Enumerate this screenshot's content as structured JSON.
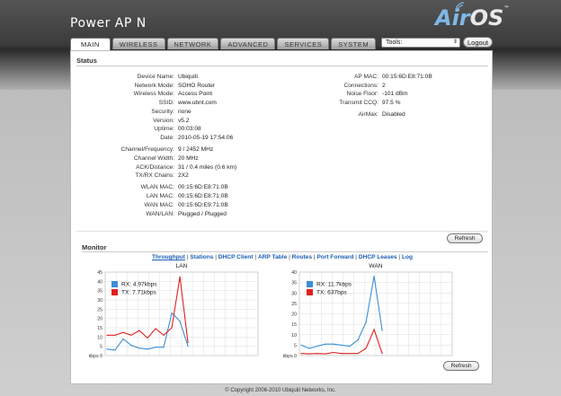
{
  "header": {
    "product": "Power AP N",
    "logo_air": "Air",
    "logo_os": "OS",
    "logo_tm": "™",
    "tabs": [
      "MAIN",
      "WIRELESS",
      "NETWORK",
      "ADVANCED",
      "SERVICES",
      "SYSTEM"
    ],
    "active_tab": "MAIN",
    "tools_label": "Tools:",
    "logout_label": "Logout"
  },
  "status": {
    "title": "Status",
    "left_group1": [
      {
        "k": "Device Name:",
        "v": "Ubiquiti"
      },
      {
        "k": "Network Mode:",
        "v": "SOHO Router"
      },
      {
        "k": "Wireless Mode:",
        "v": "Access Point"
      },
      {
        "k": "SSID:",
        "v": "www.ubnt.com"
      },
      {
        "k": "Security:",
        "v": "none"
      },
      {
        "k": "Version:",
        "v": "v5.2"
      },
      {
        "k": "Uptime:",
        "v": "00:03:08"
      },
      {
        "k": "Date:",
        "v": "2010-05-19 17:54:06"
      }
    ],
    "left_group2": [
      {
        "k": "Channel/Frequency:",
        "v": "9 / 2452 MHz"
      },
      {
        "k": "Channel Width:",
        "v": "20 MHz"
      },
      {
        "k": "ACK/Distance:",
        "v": "31 / 0.4 miles (0.6 km)"
      },
      {
        "k": "TX/RX Chains:",
        "v": "2X2"
      }
    ],
    "left_group3": [
      {
        "k": "WLAN MAC:",
        "v": "00:15:6D:E8:71:0B"
      },
      {
        "k": "LAN MAC:",
        "v": "00:15:6D:E8:71:0B"
      },
      {
        "k": "WAN MAC:",
        "v": "00:15:6D:E9:71:0B"
      },
      {
        "k": "WAN/LAN:",
        "v": "Plugged / Plugged"
      }
    ],
    "right_group1": [
      {
        "k": "AP MAC:",
        "v": "00:15:6D:E8:71:0B"
      },
      {
        "k": "Connections:",
        "v": "2"
      },
      {
        "k": "Noise Floor:",
        "v": "-101 dBm"
      },
      {
        "k": "Transmit CCQ:",
        "v": "97.5 %"
      }
    ],
    "right_group2": [
      {
        "k": "AirMax:",
        "v": "Disabled"
      }
    ],
    "refresh_label": "Refresh"
  },
  "monitor": {
    "title": "Monitor",
    "links": [
      "Throughput",
      "Stations",
      "DHCP Client",
      "ARP Table",
      "Routes",
      "Port Forward",
      "DHCP Leases",
      "Log"
    ],
    "active_link": "Throughput",
    "refresh_label": "Refresh"
  },
  "chart_data": [
    {
      "type": "line",
      "title": "LAN",
      "ylabel": "kbps",
      "ylim": [
        0,
        45
      ],
      "yticks": [
        0,
        5,
        10,
        15,
        20,
        25,
        30,
        35,
        40,
        45
      ],
      "grid": true,
      "legend": "top-left",
      "series": [
        {
          "name": "RX: 4.97kbps",
          "color": "#3a8fd6",
          "values": [
            3.5,
            3,
            9,
            5.5,
            4,
            3.5,
            4.5,
            4.5,
            23,
            18.5,
            5
          ]
        },
        {
          "name": "TX: 7.71kbps",
          "color": "#e02020",
          "values": [
            11,
            11,
            12.5,
            11,
            13.5,
            9.5,
            14.5,
            11,
            15,
            42.5,
            7
          ]
        }
      ]
    },
    {
      "type": "line",
      "title": "WAN",
      "ylabel": "kbps",
      "ylim": [
        0,
        40
      ],
      "yticks": [
        0,
        5,
        10,
        15,
        20,
        25,
        30,
        35,
        40
      ],
      "grid": true,
      "legend": "top-left",
      "series": [
        {
          "name": "RX: 11.7kbps",
          "color": "#3a8fd6",
          "values": [
            5,
            3.5,
            4.5,
            5.5,
            5.5,
            5,
            4.5,
            7.5,
            16,
            38,
            12
          ]
        },
        {
          "name": "TX: 637bps",
          "color": "#e02020",
          "values": [
            1,
            0.8,
            1,
            0.8,
            1.5,
            1,
            1,
            1,
            3.5,
            12.5,
            1
          ]
        }
      ]
    }
  ],
  "footer": "© Copyright 2006-2010 Ubiquiti Networks, Inc."
}
